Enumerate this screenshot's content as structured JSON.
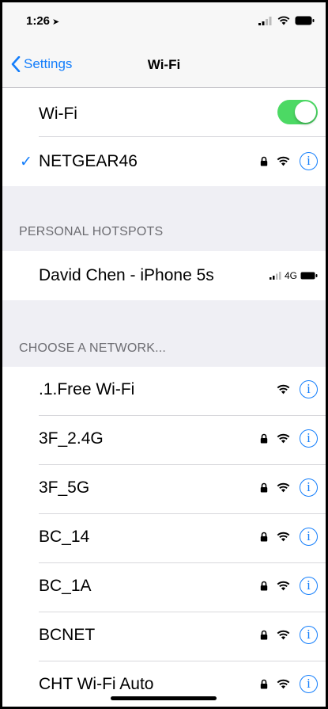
{
  "status_bar": {
    "time": "1:26",
    "location_glyph": "➤"
  },
  "nav": {
    "back_label": "Settings",
    "title": "Wi-Fi"
  },
  "wifi_toggle": {
    "label": "Wi-Fi",
    "on": true
  },
  "connected_network": {
    "name": "NETGEAR46",
    "secured": true
  },
  "personal_hotspots": {
    "header": "PERSONAL HOTSPOTS",
    "items": [
      {
        "name": "David Chen - iPhone 5s",
        "network_type": "4G"
      }
    ]
  },
  "choose_network": {
    "header": "CHOOSE A NETWORK...",
    "networks": [
      {
        "name": ".1.Free Wi-Fi",
        "secured": false
      },
      {
        "name": "3F_2.4G",
        "secured": true
      },
      {
        "name": "3F_5G",
        "secured": true
      },
      {
        "name": "BC_14",
        "secured": true
      },
      {
        "name": "BC_1A",
        "secured": true
      },
      {
        "name": "BCNET",
        "secured": true
      },
      {
        "name": "CHT Wi-Fi Auto",
        "secured": true
      }
    ]
  },
  "info_glyph": "i",
  "colors": {
    "accent": "#147efb",
    "toggle_on": "#4cd964",
    "group_bg": "#efeff4"
  }
}
